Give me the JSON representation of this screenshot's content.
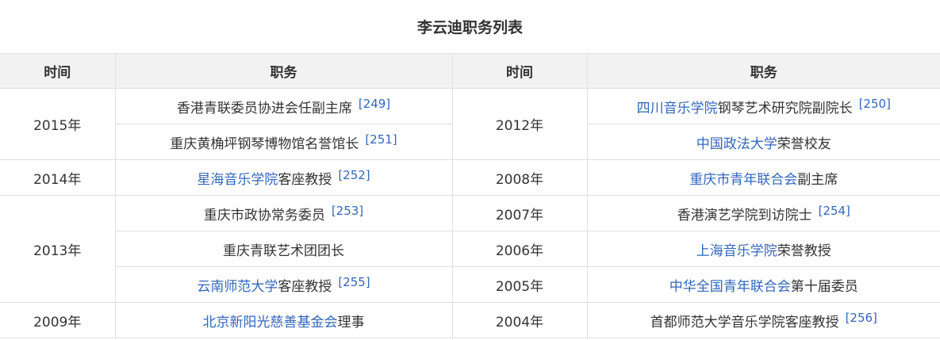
{
  "title": "李云迪职务列表",
  "headers": {
    "time_left": "时间",
    "role_left": "职务",
    "time_right": "时间",
    "role_right": "职务"
  },
  "colors": {
    "link": "#3366bb",
    "text": "#333333",
    "header_bg": "#f2f2f2",
    "border": "#e0e0e0"
  },
  "left": {
    "years": [
      "2015年",
      "2014年",
      "2013年",
      "2009年"
    ],
    "rows": [
      {
        "link": "",
        "text": "香港青联委员协进会任副主席",
        "ref": "[249]"
      },
      {
        "link": "",
        "text": "重庆黄桷坪钢琴博物馆名誉馆长",
        "ref": "[251]"
      },
      {
        "link": "星海音乐学院",
        "text": "客座教授",
        "ref": "[252]"
      },
      {
        "link": "",
        "text": "重庆市政协常务委员",
        "ref": "[253]"
      },
      {
        "link": "",
        "text": "重庆青联艺术团团长",
        "ref": ""
      },
      {
        "link": "云南师范大学",
        "text": "客座教授",
        "ref": "[255]"
      },
      {
        "link": "北京新阳光慈善基金会",
        "text": "理事",
        "ref": ""
      }
    ]
  },
  "right": {
    "years": [
      "2012年",
      "2008年",
      "2007年",
      "2006年",
      "2005年",
      "2004年"
    ],
    "rows": [
      {
        "link": "四川音乐学院",
        "text": "钢琴艺术研究院副院长",
        "ref": "[250]"
      },
      {
        "link": "中国政法大学",
        "text": "荣誉校友",
        "ref": ""
      },
      {
        "link": "重庆市青年联合会",
        "text": "副主席",
        "ref": ""
      },
      {
        "link": "",
        "text": "香港演艺学院到访院士",
        "ref": "[254]"
      },
      {
        "link": "上海音乐学院",
        "text": "荣誉教授",
        "ref": ""
      },
      {
        "link": "中华全国青年联合会",
        "text": "第十届委员",
        "ref": ""
      },
      {
        "link": "",
        "text": "首都师范大学音乐学院客座教授",
        "ref": "[256]"
      }
    ]
  }
}
